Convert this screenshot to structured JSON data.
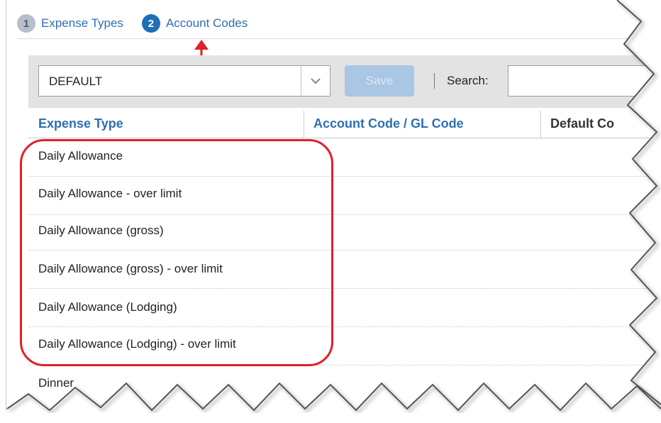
{
  "tabs": [
    {
      "number": "1",
      "label": "Expense Types",
      "active": false
    },
    {
      "number": "2",
      "label": "Account Codes",
      "active": true
    }
  ],
  "toolbar": {
    "select_value": "DEFAULT",
    "save_label": "Save",
    "search_label": "Search:"
  },
  "table": {
    "headers": [
      "Expense Type",
      "Account Code / GL Code",
      "Default Co"
    ],
    "rows": [
      "Daily Allowance",
      "Daily Allowance - over limit",
      "Daily Allowance (gross)",
      "Daily Allowance (gross) - over limit",
      "Daily Allowance (Lodging)",
      "Daily Allowance (Lodging) - over limit",
      "Dinner"
    ]
  },
  "colors": {
    "accent": "#2f6fb2",
    "active_tab": "#1f6fb8",
    "annotation": "#e0202a"
  },
  "icons": {
    "dropdown": "chevron-down-icon",
    "annotation_arrow": "arrow-up-icon"
  }
}
